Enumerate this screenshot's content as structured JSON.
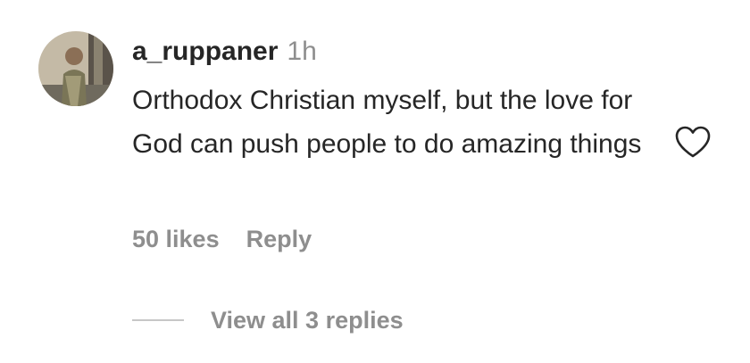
{
  "comment": {
    "username": "a_ruppaner",
    "timestamp": "1h",
    "text": "Orthodox Christian myself, but the love for God can push people to do amazing things",
    "likes_label": "50 likes",
    "reply_label": "Reply",
    "view_replies_label": "View all 3 replies",
    "like_icon": "heart-outline-icon",
    "colors": {
      "primary_text": "#262626",
      "secondary_text": "#8e8e8e",
      "divider": "#c7c7c7"
    }
  }
}
